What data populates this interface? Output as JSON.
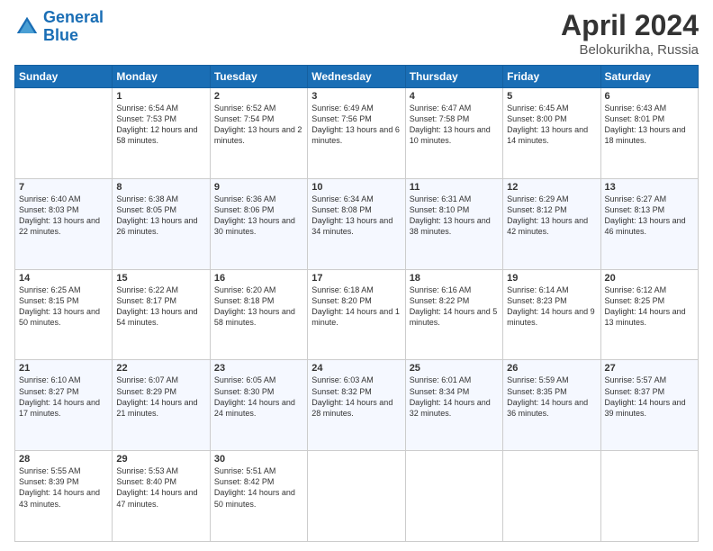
{
  "header": {
    "logo_line1": "General",
    "logo_line2": "Blue",
    "title": "April 2024",
    "subtitle": "Belokurikha, Russia"
  },
  "weekdays": [
    "Sunday",
    "Monday",
    "Tuesday",
    "Wednesday",
    "Thursday",
    "Friday",
    "Saturday"
  ],
  "weeks": [
    [
      {
        "day": "",
        "sunrise": "",
        "sunset": "",
        "daylight": ""
      },
      {
        "day": "1",
        "sunrise": "Sunrise: 6:54 AM",
        "sunset": "Sunset: 7:53 PM",
        "daylight": "Daylight: 12 hours and 58 minutes."
      },
      {
        "day": "2",
        "sunrise": "Sunrise: 6:52 AM",
        "sunset": "Sunset: 7:54 PM",
        "daylight": "Daylight: 13 hours and 2 minutes."
      },
      {
        "day": "3",
        "sunrise": "Sunrise: 6:49 AM",
        "sunset": "Sunset: 7:56 PM",
        "daylight": "Daylight: 13 hours and 6 minutes."
      },
      {
        "day": "4",
        "sunrise": "Sunrise: 6:47 AM",
        "sunset": "Sunset: 7:58 PM",
        "daylight": "Daylight: 13 hours and 10 minutes."
      },
      {
        "day": "5",
        "sunrise": "Sunrise: 6:45 AM",
        "sunset": "Sunset: 8:00 PM",
        "daylight": "Daylight: 13 hours and 14 minutes."
      },
      {
        "day": "6",
        "sunrise": "Sunrise: 6:43 AM",
        "sunset": "Sunset: 8:01 PM",
        "daylight": "Daylight: 13 hours and 18 minutes."
      }
    ],
    [
      {
        "day": "7",
        "sunrise": "Sunrise: 6:40 AM",
        "sunset": "Sunset: 8:03 PM",
        "daylight": "Daylight: 13 hours and 22 minutes."
      },
      {
        "day": "8",
        "sunrise": "Sunrise: 6:38 AM",
        "sunset": "Sunset: 8:05 PM",
        "daylight": "Daylight: 13 hours and 26 minutes."
      },
      {
        "day": "9",
        "sunrise": "Sunrise: 6:36 AM",
        "sunset": "Sunset: 8:06 PM",
        "daylight": "Daylight: 13 hours and 30 minutes."
      },
      {
        "day": "10",
        "sunrise": "Sunrise: 6:34 AM",
        "sunset": "Sunset: 8:08 PM",
        "daylight": "Daylight: 13 hours and 34 minutes."
      },
      {
        "day": "11",
        "sunrise": "Sunrise: 6:31 AM",
        "sunset": "Sunset: 8:10 PM",
        "daylight": "Daylight: 13 hours and 38 minutes."
      },
      {
        "day": "12",
        "sunrise": "Sunrise: 6:29 AM",
        "sunset": "Sunset: 8:12 PM",
        "daylight": "Daylight: 13 hours and 42 minutes."
      },
      {
        "day": "13",
        "sunrise": "Sunrise: 6:27 AM",
        "sunset": "Sunset: 8:13 PM",
        "daylight": "Daylight: 13 hours and 46 minutes."
      }
    ],
    [
      {
        "day": "14",
        "sunrise": "Sunrise: 6:25 AM",
        "sunset": "Sunset: 8:15 PM",
        "daylight": "Daylight: 13 hours and 50 minutes."
      },
      {
        "day": "15",
        "sunrise": "Sunrise: 6:22 AM",
        "sunset": "Sunset: 8:17 PM",
        "daylight": "Daylight: 13 hours and 54 minutes."
      },
      {
        "day": "16",
        "sunrise": "Sunrise: 6:20 AM",
        "sunset": "Sunset: 8:18 PM",
        "daylight": "Daylight: 13 hours and 58 minutes."
      },
      {
        "day": "17",
        "sunrise": "Sunrise: 6:18 AM",
        "sunset": "Sunset: 8:20 PM",
        "daylight": "Daylight: 14 hours and 1 minute."
      },
      {
        "day": "18",
        "sunrise": "Sunrise: 6:16 AM",
        "sunset": "Sunset: 8:22 PM",
        "daylight": "Daylight: 14 hours and 5 minutes."
      },
      {
        "day": "19",
        "sunrise": "Sunrise: 6:14 AM",
        "sunset": "Sunset: 8:23 PM",
        "daylight": "Daylight: 14 hours and 9 minutes."
      },
      {
        "day": "20",
        "sunrise": "Sunrise: 6:12 AM",
        "sunset": "Sunset: 8:25 PM",
        "daylight": "Daylight: 14 hours and 13 minutes."
      }
    ],
    [
      {
        "day": "21",
        "sunrise": "Sunrise: 6:10 AM",
        "sunset": "Sunset: 8:27 PM",
        "daylight": "Daylight: 14 hours and 17 minutes."
      },
      {
        "day": "22",
        "sunrise": "Sunrise: 6:07 AM",
        "sunset": "Sunset: 8:29 PM",
        "daylight": "Daylight: 14 hours and 21 minutes."
      },
      {
        "day": "23",
        "sunrise": "Sunrise: 6:05 AM",
        "sunset": "Sunset: 8:30 PM",
        "daylight": "Daylight: 14 hours and 24 minutes."
      },
      {
        "day": "24",
        "sunrise": "Sunrise: 6:03 AM",
        "sunset": "Sunset: 8:32 PM",
        "daylight": "Daylight: 14 hours and 28 minutes."
      },
      {
        "day": "25",
        "sunrise": "Sunrise: 6:01 AM",
        "sunset": "Sunset: 8:34 PM",
        "daylight": "Daylight: 14 hours and 32 minutes."
      },
      {
        "day": "26",
        "sunrise": "Sunrise: 5:59 AM",
        "sunset": "Sunset: 8:35 PM",
        "daylight": "Daylight: 14 hours and 36 minutes."
      },
      {
        "day": "27",
        "sunrise": "Sunrise: 5:57 AM",
        "sunset": "Sunset: 8:37 PM",
        "daylight": "Daylight: 14 hours and 39 minutes."
      }
    ],
    [
      {
        "day": "28",
        "sunrise": "Sunrise: 5:55 AM",
        "sunset": "Sunset: 8:39 PM",
        "daylight": "Daylight: 14 hours and 43 minutes."
      },
      {
        "day": "29",
        "sunrise": "Sunrise: 5:53 AM",
        "sunset": "Sunset: 8:40 PM",
        "daylight": "Daylight: 14 hours and 47 minutes."
      },
      {
        "day": "30",
        "sunrise": "Sunrise: 5:51 AM",
        "sunset": "Sunset: 8:42 PM",
        "daylight": "Daylight: 14 hours and 50 minutes."
      },
      {
        "day": "",
        "sunrise": "",
        "sunset": "",
        "daylight": ""
      },
      {
        "day": "",
        "sunrise": "",
        "sunset": "",
        "daylight": ""
      },
      {
        "day": "",
        "sunrise": "",
        "sunset": "",
        "daylight": ""
      },
      {
        "day": "",
        "sunrise": "",
        "sunset": "",
        "daylight": ""
      }
    ]
  ]
}
